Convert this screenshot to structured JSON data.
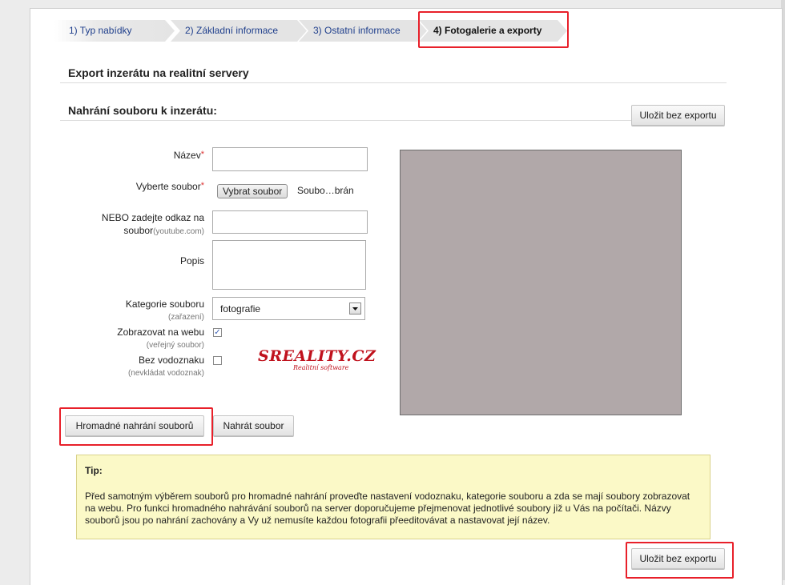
{
  "steps": [
    {
      "label": "1) Typ nabídky"
    },
    {
      "label": "2) Základní informace"
    },
    {
      "label": "3) Ostatní informace"
    },
    {
      "label": "4) Fotogalerie a exporty"
    }
  ],
  "export_title": "Export inzerátu na realitní servery",
  "upload_title": "Nahrání souboru k inzerátu:",
  "save_without_export": "Uložit bez exportu",
  "form": {
    "name_label": "Název",
    "name_value": "",
    "file_label": "Vyberte soubor",
    "file_button": "Vybrat soubor",
    "file_status": "Soubo…brán",
    "link_label_1": "NEBO zadejte odkaz na",
    "link_label_2": "soubor",
    "link_hint": "(youtube.com)",
    "link_value": "",
    "desc_label": "Popis",
    "desc_value": "",
    "category_label": "Kategorie souboru",
    "category_hint": "(zařazení)",
    "category_value": "fotografie",
    "show_web_label": "Zobrazovat na webu",
    "show_web_hint": "(veřejný soubor)",
    "show_web_checked": true,
    "no_watermark_label": "Bez vodoznaku",
    "no_watermark_hint": "(nevkládat vodoznak)",
    "no_watermark_checked": false,
    "required_mark": "*"
  },
  "logo": {
    "main": "SREALITY.CZ",
    "sub": "Realitní software"
  },
  "bulk_upload": "Hromadné nahrání souborů",
  "upload_file": "Nahrát soubor",
  "tip": {
    "title": "Tip:",
    "text": "Před samotným výběrem souborů pro hromadné nahrání proveďte nastavení vodoznaku, kategorie souboru a zda se mají soubory zobrazovat na webu. Pro funkci hromadného nahrávání souborů na server doporučujeme přejmenovat jednotlivé soubory již u Vás na počítači. Názvy souborů jsou po nahrání zachovány a Vy už nemusíte každou fotografii přeeditovávat a nastavovat její název."
  },
  "colors": {
    "highlight": "#e8202a",
    "link": "#1f3f8c",
    "tip_bg": "#fbf9c7",
    "preview_bg": "#b1a8a9"
  }
}
